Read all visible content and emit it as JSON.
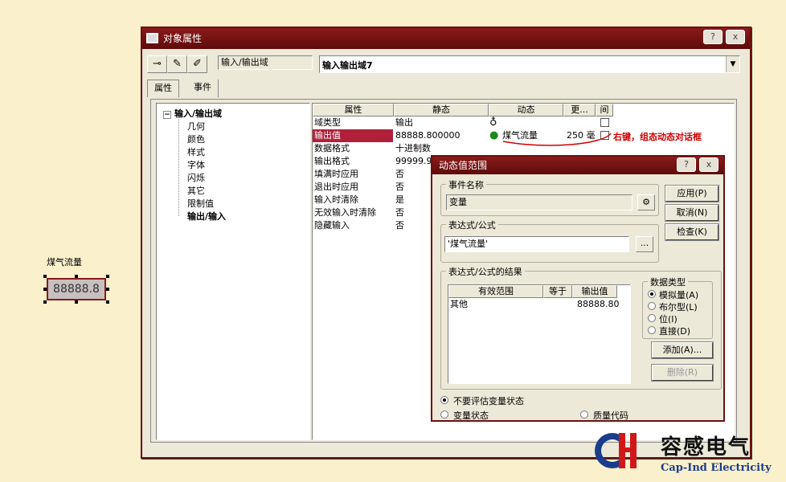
{
  "canvas": {
    "object_label": "煤气流量",
    "object_value": "88888.8"
  },
  "window": {
    "title": "对象属性",
    "help_button": "?",
    "close_button": "x",
    "object_type": "输入/输出域",
    "object_name": "输入输出域7",
    "tabs": [
      {
        "label": "属性",
        "active": true
      },
      {
        "label": "事件",
        "active": false
      }
    ],
    "tree": {
      "root": "输入/输出域",
      "children": [
        "几何",
        "颜色",
        "样式",
        "字体",
        "闪烁",
        "其它",
        "限制值",
        "输出/输入"
      ],
      "selected": "输出/输入"
    },
    "grid": {
      "headers": [
        "属性",
        "静态",
        "动态",
        "更...",
        "间"
      ],
      "rows": [
        {
          "prop": "域类型",
          "static": "输出",
          "dynamic": "",
          "update": ""
        },
        {
          "prop": "输出值",
          "static": "88888.800000",
          "dynamic": "煤气流量",
          "update": "250 毫"
        },
        {
          "prop": "数据格式",
          "static": "十进制数",
          "dynamic": "",
          "update": ""
        },
        {
          "prop": "输出格式",
          "static": "99999.9",
          "dynamic": "",
          "update": ""
        },
        {
          "prop": "填满时应用",
          "static": "否",
          "dynamic": "",
          "update": ""
        },
        {
          "prop": "退出时应用",
          "static": "否",
          "dynamic": "",
          "update": ""
        },
        {
          "prop": "输入时清除",
          "static": "是",
          "dynamic": "",
          "update": ""
        },
        {
          "prop": "无效输入时清除",
          "static": "否",
          "dynamic": "",
          "update": ""
        },
        {
          "prop": "隐藏输入",
          "static": "否",
          "dynamic": "",
          "update": ""
        }
      ]
    },
    "annotation": "右键，组态动态对话框"
  },
  "dialog": {
    "title": "动态值范围",
    "help_button": "?",
    "close_button": "x",
    "event_group": "事件名称",
    "event_value": "变量",
    "expr_group": "表达式/公式",
    "expr_value": "'煤气流量'",
    "browse_button": "...",
    "result_group": "表达式/公式的结果",
    "result_headers": [
      "有效范围",
      "等于",
      "输出值"
    ],
    "result_rows": [
      {
        "range": "其他",
        "equal": "",
        "value": "88888.80"
      }
    ],
    "data_type_group": "数据类型",
    "data_types": [
      {
        "label": "模拟量(A)",
        "selected": true
      },
      {
        "label": "布尔型(L)",
        "selected": false
      },
      {
        "label": "位(I)",
        "selected": false
      },
      {
        "label": "直接(D)",
        "selected": false
      }
    ],
    "buttons": {
      "apply": "应用(P)",
      "cancel": "取消(N)",
      "check": "检查(K)",
      "add": "添加(A)...",
      "delete": "删除(R)"
    },
    "eval_options": [
      {
        "label": "不要评估变量状态",
        "selected": true
      },
      {
        "label": "变量状态",
        "selected": false
      },
      {
        "label": "质量代码",
        "selected": false
      }
    ]
  },
  "logo": {
    "name_cn": "容感电气",
    "name_en": "Cap-Ind Electricity"
  },
  "colors": {
    "background": "#fbf0cc",
    "title_bar": "#8b1a1a",
    "selection": "#b0203a",
    "annotation": "#d00000"
  }
}
